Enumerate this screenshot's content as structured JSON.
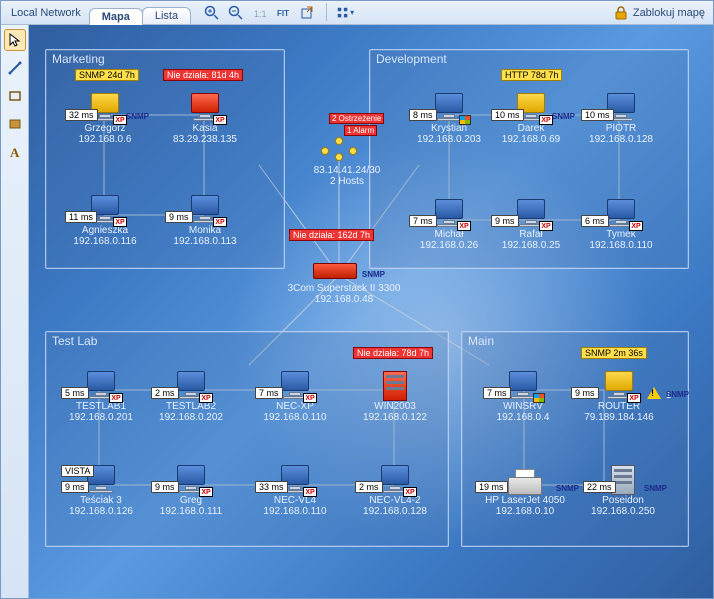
{
  "breadcrumb": "Local Network",
  "tabs": {
    "map": "Mapa",
    "list": "Lista"
  },
  "lock_label": "Zablokuj mapę",
  "groups": {
    "marketing": {
      "title": "Marketing"
    },
    "development": {
      "title": "Development"
    },
    "testlab": {
      "title": "Test Lab"
    },
    "main": {
      "title": "Main"
    }
  },
  "center": {
    "warnings": "2 Ostrzeżenie",
    "alarms": "1 Alarm",
    "subnet": "83.14.41.24/30",
    "hosts": "2 Hosts",
    "switch_fail": "Nie działa: 162d 7h",
    "switch_name": "3Com Superstack II 3300",
    "switch_ip": "192.168.0.48",
    "switch_snmp": "SNMP"
  },
  "nodes": {
    "grzegorz": {
      "name": "Grzegorz",
      "ip": "192.168.0.6",
      "ping": "32 ms",
      "overlay": "SNMP 24d 7h",
      "snmp": "SNMP"
    },
    "kasia": {
      "name": "Kasia",
      "ip": "83.29.238.135",
      "overlay": "Nie działa: 81d 4h"
    },
    "agnieszka": {
      "name": "Agnieszka",
      "ip": "192.168.0.116",
      "ping": "11 ms"
    },
    "monika": {
      "name": "Monika",
      "ip": "192.168.0.113",
      "ping": "9 ms"
    },
    "krystian": {
      "name": "Krystian",
      "ip": "192.168.0.203",
      "ping": "8 ms"
    },
    "darek": {
      "name": "Darek",
      "ip": "192.168.0.69",
      "ping": "10 ms",
      "overlay": "HTTP 78d 7h",
      "snmp": "SNMP"
    },
    "piotr": {
      "name": "PIOTR",
      "ip": "192.168.0.128",
      "ping": "10 ms"
    },
    "michal": {
      "name": "Michał",
      "ip": "192.168.0.26",
      "ping": "7 ms"
    },
    "rafal": {
      "name": "Rafał",
      "ip": "192.168.0.25",
      "ping": "9 ms"
    },
    "tymek": {
      "name": "Tymek",
      "ip": "192.168.0.110",
      "ping": "6 ms"
    },
    "testlab1": {
      "name": "TESTLAB1",
      "ip": "192.168.0.201",
      "ping": "5 ms"
    },
    "testlab2": {
      "name": "TESTLAB2",
      "ip": "192.168.0.202",
      "ping": "2 ms"
    },
    "necxp": {
      "name": "NEC-XP",
      "ip": "192.168.0.110",
      "ping": "7 ms"
    },
    "win2003": {
      "name": "WIN2003",
      "ip": "192.168.0.122",
      "overlay": "Nie działa: 78d 7h"
    },
    "tesciak3": {
      "name": "Teściak 3",
      "ip": "192.168.0.126",
      "ping": "9 ms",
      "badge2": "VISTA"
    },
    "greg": {
      "name": "Greg",
      "ip": "192.168.0.111",
      "ping": "9 ms"
    },
    "necvl4": {
      "name": "NEC-VL4",
      "ip": "192.168.0.110",
      "ping": "33 ms"
    },
    "necvl42": {
      "name": "NEC-VL4-2",
      "ip": "192.168.0.128",
      "ping": "2 ms"
    },
    "winsrv": {
      "name": "WINSRV",
      "ip": "192.168.0.4",
      "ping": "7 ms"
    },
    "router": {
      "name": "ROUTER",
      "ip": "79.189.184.146",
      "ping": "9 ms",
      "overlay": "SNMP 2m 36s",
      "snmp": "SNMP",
      "warn": "1"
    },
    "hplj": {
      "name": "HP LaserJet 4050",
      "ip": "192.168.0.10",
      "ping": "19 ms",
      "snmp": "SNMP"
    },
    "poseidon": {
      "name": "Poseidon",
      "ip": "192.168.0.250",
      "ping": "22 ms",
      "snmp": "SNMP"
    }
  }
}
